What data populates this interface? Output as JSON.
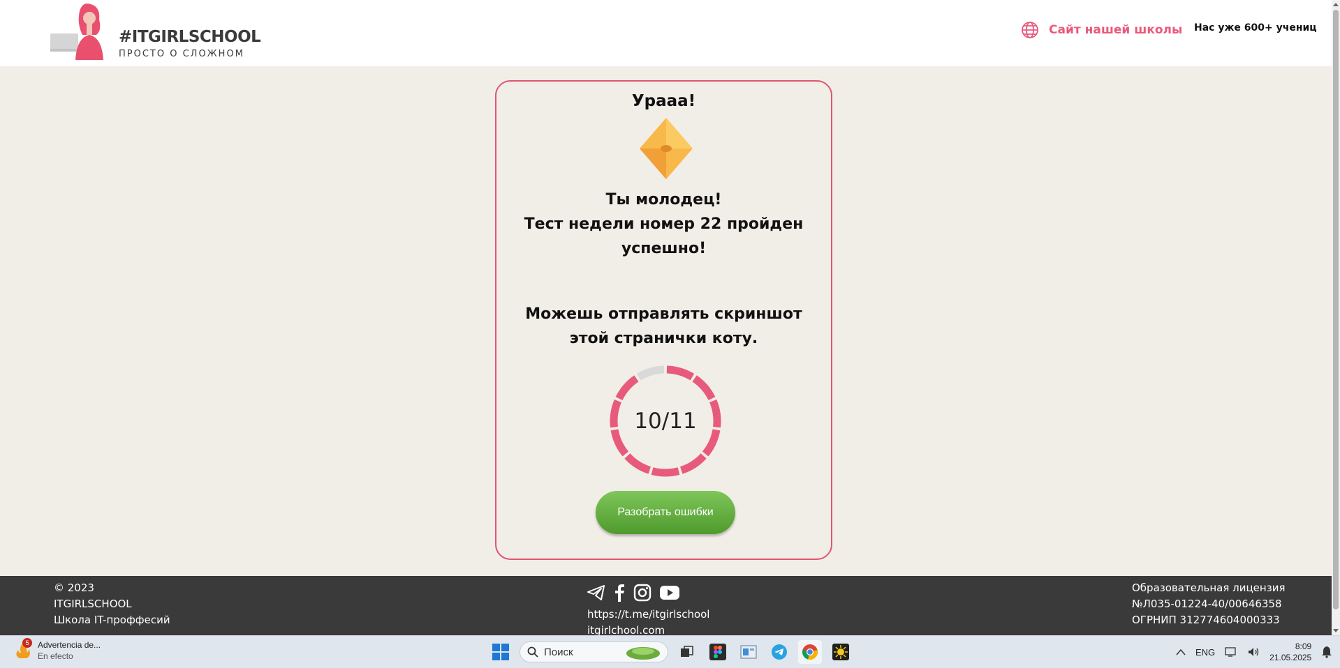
{
  "header": {
    "brand_title": "#ITGIRLSCHOOL",
    "brand_subtitle": "ПРОСТО О СЛОЖНОМ",
    "site_link": "Сайт нашей школы",
    "students": "Нас уже 600+ учениц"
  },
  "card": {
    "title": "Урааа!",
    "congrats_line1": "Ты молодец!",
    "congrats_line2": "Тест недели номер 22 пройден успешно!",
    "send_text": "Можешь отправлять скриншот этой странички коту.",
    "score": "10/11",
    "correct": 10,
    "total": 11,
    "review_button": "Разобрать ошибки",
    "colors": {
      "accent": "#e85a7b",
      "ring_empty": "#d9d9d9",
      "button": "#5fae3a"
    }
  },
  "footer": {
    "left": [
      "© 2023",
      "ITGIRLSCHOOL",
      "Школа IT-проффесий"
    ],
    "social_icons": [
      "telegram-icon",
      "facebook-icon",
      "instagram-icon",
      "youtube-icon"
    ],
    "links": [
      "https://t.me/itgirlschool",
      "itgirlchool.com"
    ],
    "right": [
      "Образовательная лицензия",
      "№Л035-01224-40/00646358",
      "ОГРНИП 312774604000333"
    ]
  },
  "taskbar": {
    "notification_title": "Advertencia de...",
    "notification_sub": "En efecto",
    "notification_count": "5",
    "search_placeholder": "Поиск",
    "language": "ENG",
    "time": "8:09",
    "date": "21.05.2025"
  }
}
